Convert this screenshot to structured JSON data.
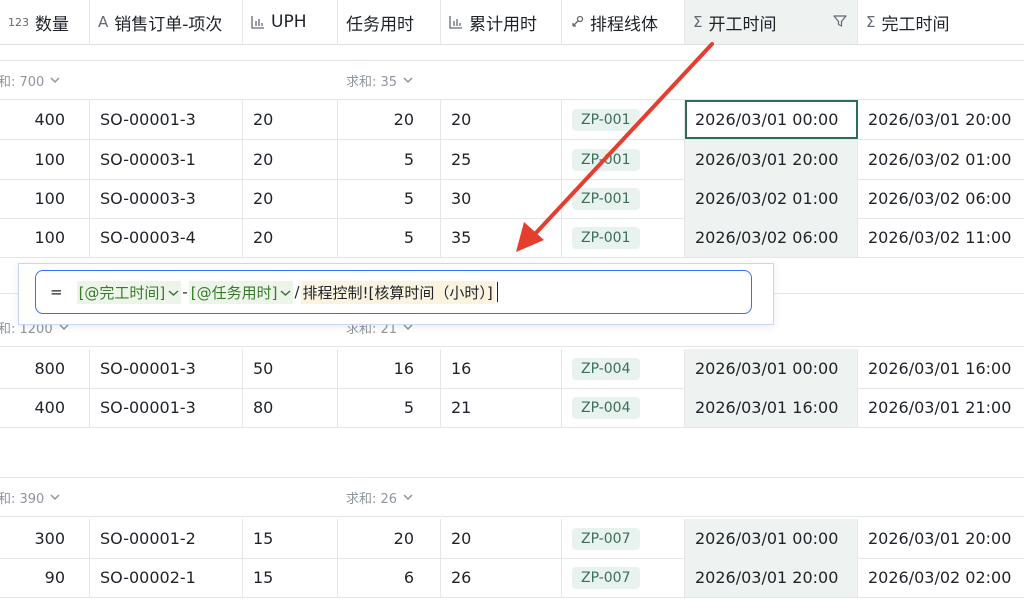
{
  "columns": [
    {
      "icon": "number-icon",
      "icon_text": "123",
      "label": "数量"
    },
    {
      "icon": "text-icon",
      "icon_text": "A",
      "label": "销售订单-项次"
    },
    {
      "icon": "bar-chart-icon",
      "icon_text": "",
      "label": "UPH"
    },
    {
      "icon": "",
      "icon_text": "",
      "label": "任务用时"
    },
    {
      "icon": "bar-chart-icon",
      "icon_text": "",
      "label": "累计用时"
    },
    {
      "icon": "link-icon",
      "icon_text": "",
      "label": "排程线体"
    },
    {
      "icon": "sigma-icon",
      "icon_text": "Σ",
      "label": "开工时间"
    },
    {
      "icon": "sigma-icon",
      "icon_text": "Σ",
      "label": "完工时间"
    }
  ],
  "groups": [
    {
      "sum_qty": "和: 700",
      "sum_task": "求和: 35",
      "rows": [
        {
          "qty": "400",
          "order": "SO-00001-3",
          "uph": "20",
          "task": "20",
          "cum": "20",
          "line": "ZP-001",
          "start": "2026/03/01 00:00",
          "end": "2026/03/01 20:00"
        },
        {
          "qty": "100",
          "order": "SO-00003-1",
          "uph": "20",
          "task": "5",
          "cum": "25",
          "line": "ZP-001",
          "start": "2026/03/01 20:00",
          "end": "2026/03/02 01:00"
        },
        {
          "qty": "100",
          "order": "SO-00003-3",
          "uph": "20",
          "task": "5",
          "cum": "30",
          "line": "ZP-001",
          "start": "2026/03/02 01:00",
          "end": "2026/03/02 06:00"
        },
        {
          "qty": "100",
          "order": "SO-00003-4",
          "uph": "20",
          "task": "5",
          "cum": "35",
          "line": "ZP-001",
          "start": "2026/03/02 06:00",
          "end": "2026/03/02 11:00"
        }
      ]
    },
    {
      "sum_qty": "和: 1200",
      "sum_task": "求和: 21",
      "rows": [
        {
          "qty": "800",
          "order": "SO-00001-3",
          "uph": "50",
          "task": "16",
          "cum": "16",
          "line": "ZP-004",
          "start": "2026/03/01 00:00",
          "end": "2026/03/01 16:00"
        },
        {
          "qty": "400",
          "order": "SO-00001-3",
          "uph": "80",
          "task": "5",
          "cum": "21",
          "line": "ZP-004",
          "start": "2026/03/01 16:00",
          "end": "2026/03/01 21:00"
        }
      ]
    },
    {
      "sum_qty": "和: 390",
      "sum_task": "求和: 26",
      "rows": [
        {
          "qty": "300",
          "order": "SO-00001-2",
          "uph": "15",
          "task": "20",
          "cum": "20",
          "line": "ZP-007",
          "start": "2026/03/01 00:00",
          "end": "2026/03/01 20:00"
        },
        {
          "qty": "90",
          "order": "SO-00002-1",
          "uph": "15",
          "task": "6",
          "cum": "26",
          "line": "ZP-007",
          "start": "2026/03/01 20:00",
          "end": "2026/03/02 02:00"
        }
      ]
    }
  ],
  "formula": {
    "eq": "=",
    "token1": "[@完工时间]",
    "op1": "-",
    "token2": "[@任务用时]",
    "op2": "/",
    "ref": "排程控制![核算时间（小时）]"
  },
  "colors": {
    "accent": "#3370ff",
    "arrow": "#e53d2e",
    "tag_bg": "#e8f3ef",
    "selected_col": "#eef2f0"
  }
}
